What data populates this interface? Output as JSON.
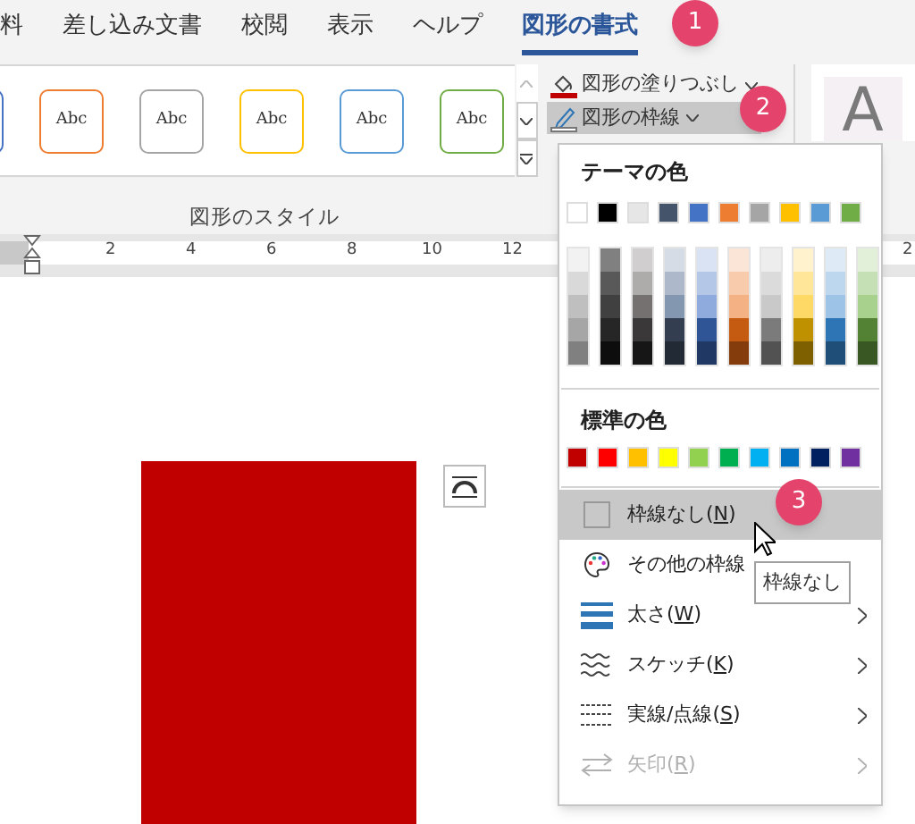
{
  "tabs": [
    {
      "label": "料",
      "selected": false
    },
    {
      "label": "差し込み文書",
      "selected": false
    },
    {
      "label": "校閲",
      "selected": false
    },
    {
      "label": "表示",
      "selected": false
    },
    {
      "label": "ヘルプ",
      "selected": false
    },
    {
      "label": "図形の書式",
      "selected": true
    }
  ],
  "step_badges": [
    "1",
    "2",
    "3"
  ],
  "style_gallery": {
    "items": [
      {
        "color": "#4472c4"
      },
      {
        "color": "#ed7d31",
        "label": "Abc"
      },
      {
        "color": "#a5a5a5",
        "label": "Abc"
      },
      {
        "color": "#ffc000",
        "label": "Abc"
      },
      {
        "color": "#5b9bd5",
        "label": "Abc"
      },
      {
        "color": "#70ad47",
        "label": "Abc"
      }
    ],
    "group_label": "図形のスタイル"
  },
  "shape_fill": {
    "label": "図形の塗りつぶし",
    "color": "#c00000"
  },
  "shape_outline": {
    "label": "図形の枠線",
    "open": true
  },
  "wordart": {
    "letter": "A"
  },
  "ruler": {
    "labels": [
      "2",
      "4",
      "6",
      "8",
      "10",
      "12"
    ],
    "edge_label": "2"
  },
  "shape": {
    "color": "#c00000"
  },
  "outline_menu": {
    "theme_heading": "テーマの色",
    "theme_colors": [
      {
        "color": "#ffffff",
        "shades": [
          {
            "color": "#f2f2f2"
          },
          {
            "color": "#d9d9d9"
          },
          {
            "color": "#bfbfbf"
          },
          {
            "color": "#a6a6a6"
          },
          {
            "color": "#808080"
          }
        ]
      },
      {
        "color": "#000000",
        "shades": [
          {
            "color": "#808080"
          },
          {
            "color": "#595959"
          },
          {
            "color": "#404040"
          },
          {
            "color": "#262626"
          },
          {
            "color": "#0d0d0d"
          }
        ]
      },
      {
        "color": "#e7e6e6",
        "shades": [
          {
            "color": "#d0cece"
          },
          {
            "color": "#aeabab"
          },
          {
            "color": "#757171"
          },
          {
            "color": "#3a3838"
          },
          {
            "color": "#171616"
          }
        ]
      },
      {
        "color": "#44546a",
        "shades": [
          {
            "color": "#d6dce5"
          },
          {
            "color": "#adb9ca"
          },
          {
            "color": "#8497b0"
          },
          {
            "color": "#333f50"
          },
          {
            "color": "#222a35"
          }
        ]
      },
      {
        "color": "#4472c4",
        "shades": [
          {
            "color": "#dae3f3"
          },
          {
            "color": "#b4c7e7"
          },
          {
            "color": "#8faadc"
          },
          {
            "color": "#2f5597"
          },
          {
            "color": "#203864"
          }
        ]
      },
      {
        "color": "#ed7d31",
        "shades": [
          {
            "color": "#fbe5d6"
          },
          {
            "color": "#f8cbad"
          },
          {
            "color": "#f4b183"
          },
          {
            "color": "#c55a11"
          },
          {
            "color": "#843c0c"
          }
        ]
      },
      {
        "color": "#a5a5a5",
        "shades": [
          {
            "color": "#ededed"
          },
          {
            "color": "#dbdbdb"
          },
          {
            "color": "#c9c9c9"
          },
          {
            "color": "#7b7b7b"
          },
          {
            "color": "#525252"
          }
        ]
      },
      {
        "color": "#ffc000",
        "shades": [
          {
            "color": "#fff2cc"
          },
          {
            "color": "#ffe699"
          },
          {
            "color": "#ffd966"
          },
          {
            "color": "#bf9000"
          },
          {
            "color": "#7f6000"
          }
        ]
      },
      {
        "color": "#5b9bd5",
        "shades": [
          {
            "color": "#deebf7"
          },
          {
            "color": "#bdd7ee"
          },
          {
            "color": "#9dc3e6"
          },
          {
            "color": "#2e75b6"
          },
          {
            "color": "#1f4e79"
          }
        ]
      },
      {
        "color": "#70ad47",
        "shades": [
          {
            "color": "#e2f0d9"
          },
          {
            "color": "#c5e0b4"
          },
          {
            "color": "#a9d18e"
          },
          {
            "color": "#548235"
          },
          {
            "color": "#385723"
          }
        ]
      }
    ],
    "standard_heading": "標準の色",
    "standard_colors": [
      {
        "color": "#c00000"
      },
      {
        "color": "#ff0000"
      },
      {
        "color": "#ffc000"
      },
      {
        "color": "#ffff00"
      },
      {
        "color": "#92d050"
      },
      {
        "color": "#00b050"
      },
      {
        "color": "#00b0f0"
      },
      {
        "color": "#0070c0"
      },
      {
        "color": "#002060"
      },
      {
        "color": "#7030a0"
      }
    ],
    "items": [
      {
        "kind": "none",
        "before": "枠線なし(",
        "accel": "N",
        "after": ")",
        "selected": true,
        "disabled": false,
        "submenu": false
      },
      {
        "kind": "more_colors",
        "before": "その他の枠線",
        "selected": false,
        "disabled": false,
        "submenu": false
      },
      {
        "kind": "weight",
        "before": "太さ(",
        "accel": "W",
        "after": ")",
        "selected": false,
        "disabled": false,
        "submenu": true
      },
      {
        "kind": "sketch",
        "before": "スケッチ(",
        "accel": "K",
        "after": ")",
        "selected": false,
        "disabled": false,
        "submenu": true
      },
      {
        "kind": "dashes",
        "before": "実線/点線(",
        "accel": "S",
        "after": ")",
        "selected": false,
        "disabled": false,
        "submenu": true
      },
      {
        "kind": "arrows",
        "before": "矢印(",
        "accel": "R",
        "after": ")",
        "selected": false,
        "disabled": true,
        "submenu": true
      }
    ]
  },
  "tooltip": "枠線なし"
}
